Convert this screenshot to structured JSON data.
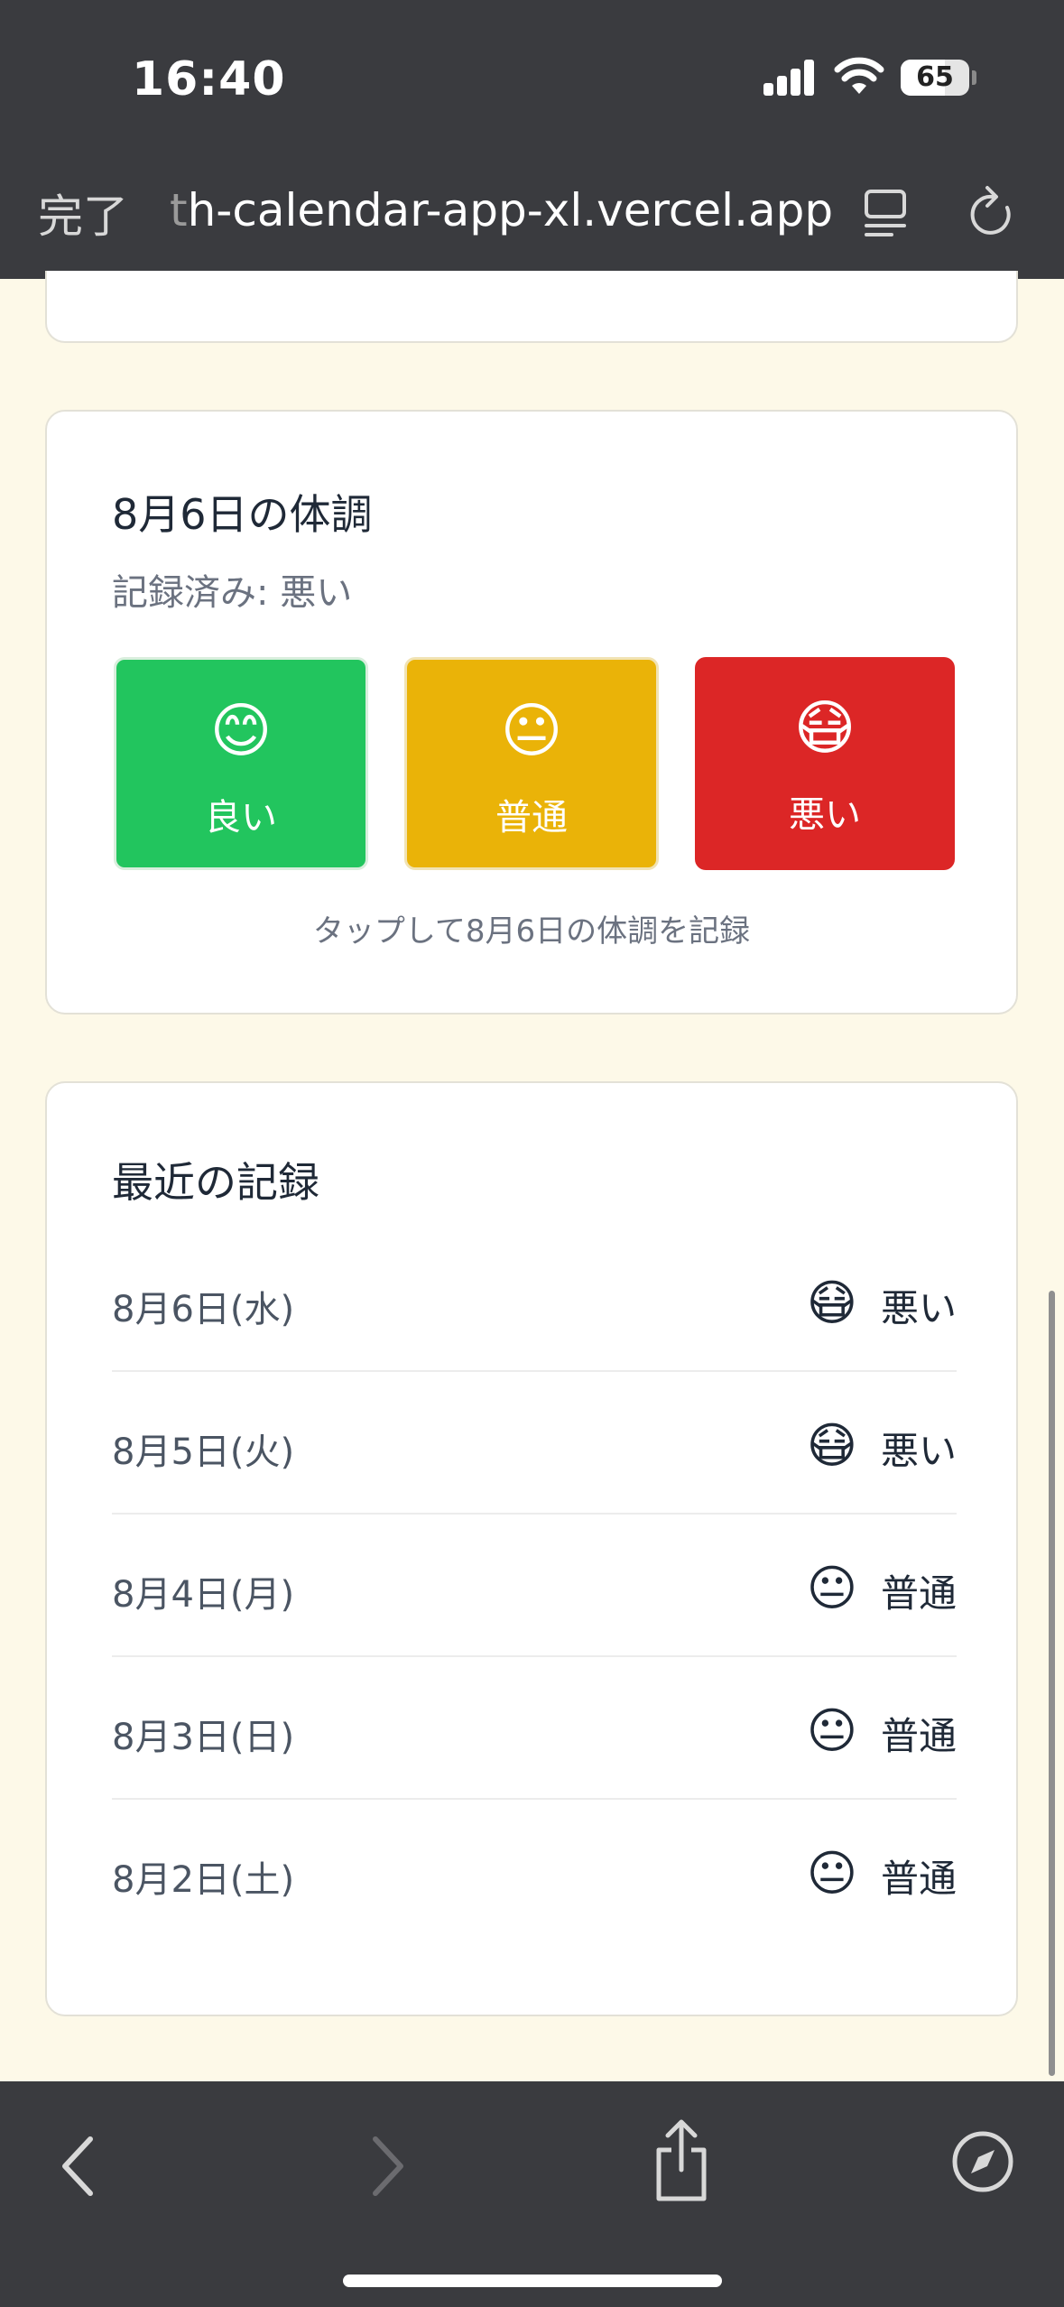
{
  "status": {
    "time": "16:40",
    "battery": "65"
  },
  "browser": {
    "done_label": "完了",
    "url_faded": "t",
    "url": "h-calendar-app-xl.vercel.app"
  },
  "mood_card": {
    "title": "8月6日の体調",
    "recorded": "記録済み: 悪い",
    "buttons": [
      {
        "emoji": "😊",
        "label": "良い",
        "color": "#22c55e"
      },
      {
        "emoji": "😐",
        "label": "普通",
        "color": "#eab308"
      },
      {
        "emoji": "😷",
        "label": "悪い",
        "color": "#dc2626"
      }
    ],
    "hint": "タップして8月6日の体調を記録"
  },
  "recent": {
    "title": "最近の記録",
    "rows": [
      {
        "date": "8月6日(水)",
        "emoji": "😷",
        "label": "悪い"
      },
      {
        "date": "8月5日(火)",
        "emoji": "😷",
        "label": "悪い"
      },
      {
        "date": "8月4日(月)",
        "emoji": "😐",
        "label": "普通"
      },
      {
        "date": "8月3日(日)",
        "emoji": "😐",
        "label": "普通"
      },
      {
        "date": "8月2日(土)",
        "emoji": "😐",
        "label": "普通"
      }
    ]
  }
}
